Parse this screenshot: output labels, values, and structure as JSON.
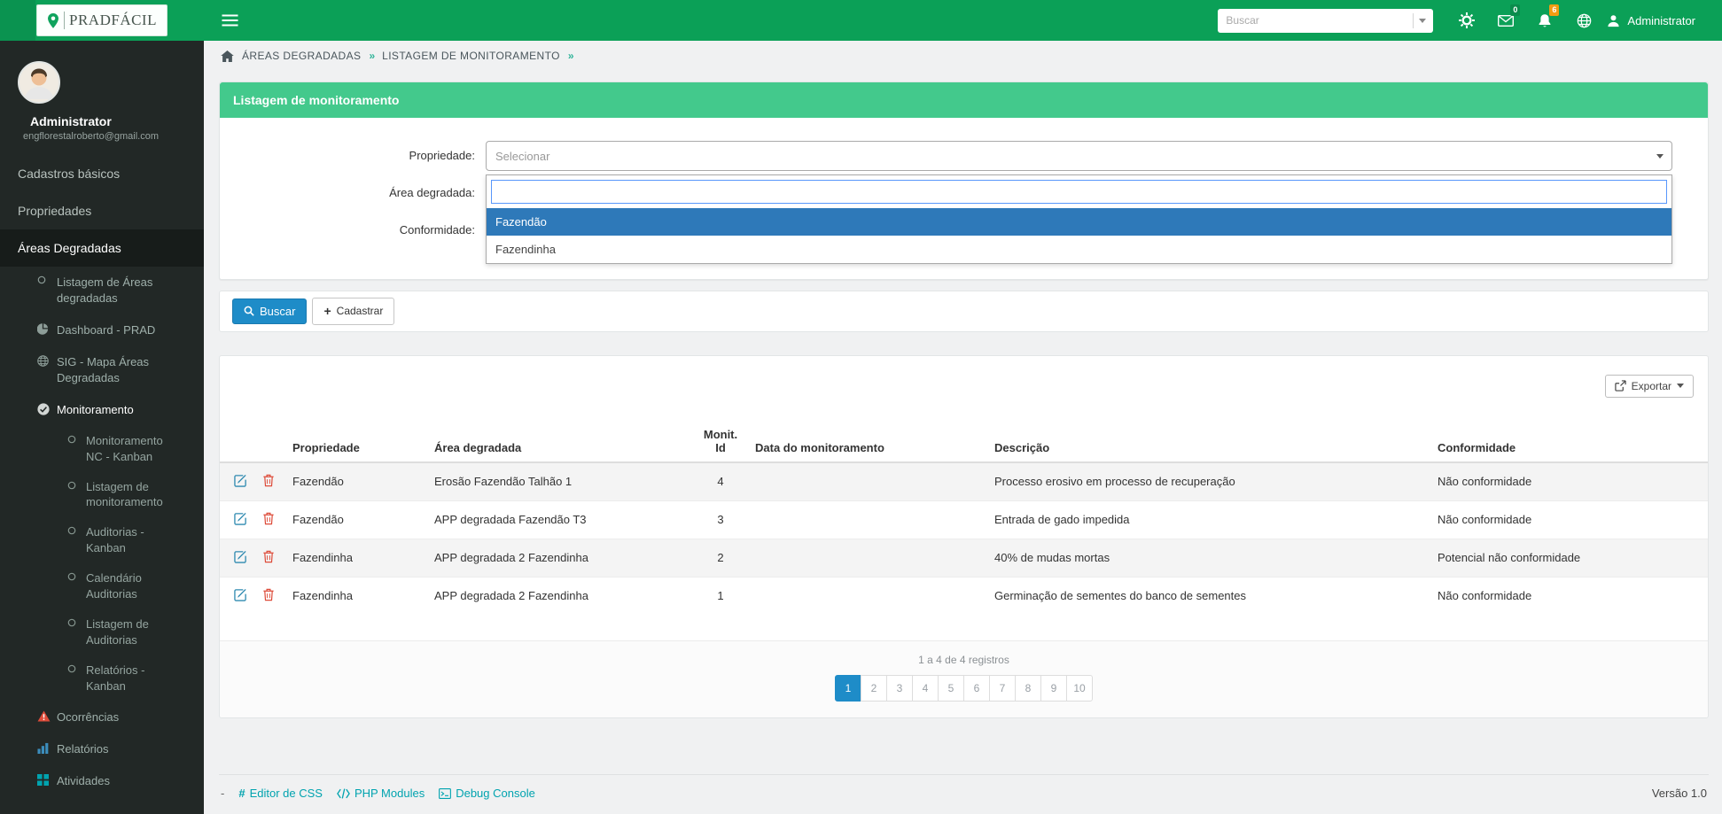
{
  "colors": {
    "brand_green": "#0ba057",
    "panel_header_green": "#43c98c",
    "primary_blue": "#1e8cc8",
    "dropdown_highlight_blue": "#2e79b9",
    "danger_red": "#dd4b39",
    "warning_orange": "#f39c12",
    "footer_link_teal": "#00a3af"
  },
  "brand": {
    "name": "PRADFÁCIL"
  },
  "topbar": {
    "search": {
      "placeholder": "Buscar"
    },
    "messages_badge": "0",
    "alerts_badge": "6",
    "user_label": "Administrator"
  },
  "sidebar": {
    "user": {
      "name": "Administrator",
      "email": "engflorestalroberto@gmail.com"
    },
    "items": [
      {
        "label": "Cadastros básicos"
      },
      {
        "label": "Propriedades"
      },
      {
        "label": "Áreas Degradadas"
      },
      {
        "label": "Listagem de Áreas degradadas"
      },
      {
        "label": "Dashboard - PRAD"
      },
      {
        "label": "SIG - Mapa Áreas Degradadas"
      },
      {
        "label": "Monitoramento"
      },
      {
        "label": "Monitoramento NC - Kanban"
      },
      {
        "label": "Listagem de monitoramento"
      },
      {
        "label": "Auditorias - Kanban"
      },
      {
        "label": "Calendário Auditorias"
      },
      {
        "label": "Listagem de Auditorias"
      },
      {
        "label": "Relatórios - Kanban"
      },
      {
        "label": "Ocorrências"
      },
      {
        "label": "Relatórios"
      },
      {
        "label": "Atividades"
      }
    ]
  },
  "breadcrumb": {
    "separator": "»",
    "items": [
      "ÁREAS DEGRADADAS",
      "LISTAGEM DE MONITORAMENTO"
    ]
  },
  "filter_panel": {
    "title": "Listagem de monitoramento",
    "labels": {
      "propriedade": "Propriedade:",
      "area": "Área degradada:",
      "conformidade": "Conformidade:"
    },
    "select_placeholder": "Selecionar",
    "dropdown": {
      "search_value": "",
      "options": [
        "Fazendão",
        "Fazendinha"
      ]
    }
  },
  "actions": {
    "buscar": "Buscar",
    "cadastrar": "Cadastrar",
    "plus": "+"
  },
  "table": {
    "export_label": "Exportar",
    "headers": {
      "propriedade": "Propriedade",
      "area": "Área degradada",
      "monit_line1": "Monit.",
      "monit_line2": "Id",
      "data": "Data do monitoramento",
      "descricao": "Descrição",
      "conformidade": "Conformidade"
    },
    "rows": [
      {
        "propriedade": "Fazendão",
        "area": "Erosão Fazendão Talhão 1",
        "monit_id": "4",
        "data": "",
        "descricao": "Processo erosivo em processo de recuperação",
        "conformidade": "Não conformidade"
      },
      {
        "propriedade": "Fazendão",
        "area": "APP degradada Fazendão T3",
        "monit_id": "3",
        "data": "",
        "descricao": "Entrada de gado impedida",
        "conformidade": "Não conformidade"
      },
      {
        "propriedade": "Fazendinha",
        "area": "APP degradada 2 Fazendinha",
        "monit_id": "2",
        "data": "",
        "descricao": "40% de mudas mortas",
        "conformidade": "Potencial não conformidade"
      },
      {
        "propriedade": "Fazendinha",
        "area": "APP degradada 2 Fazendinha",
        "monit_id": "1",
        "data": "",
        "descricao": "Germinação de sementes do banco de sementes",
        "conformidade": "Não conformidade"
      }
    ],
    "pagination": {
      "summary": "1 a 4 de 4 registros",
      "pages": [
        "1",
        "2",
        "3",
        "4",
        "5",
        "6",
        "7",
        "8",
        "9",
        "10"
      ],
      "active_page": "1"
    }
  },
  "footer": {
    "prefix": "-",
    "links": [
      {
        "icon": "#",
        "label": "Editor de CSS"
      },
      {
        "label": "PHP Modules"
      },
      {
        "label": "Debug Console"
      }
    ],
    "version": "Versão 1.0"
  }
}
